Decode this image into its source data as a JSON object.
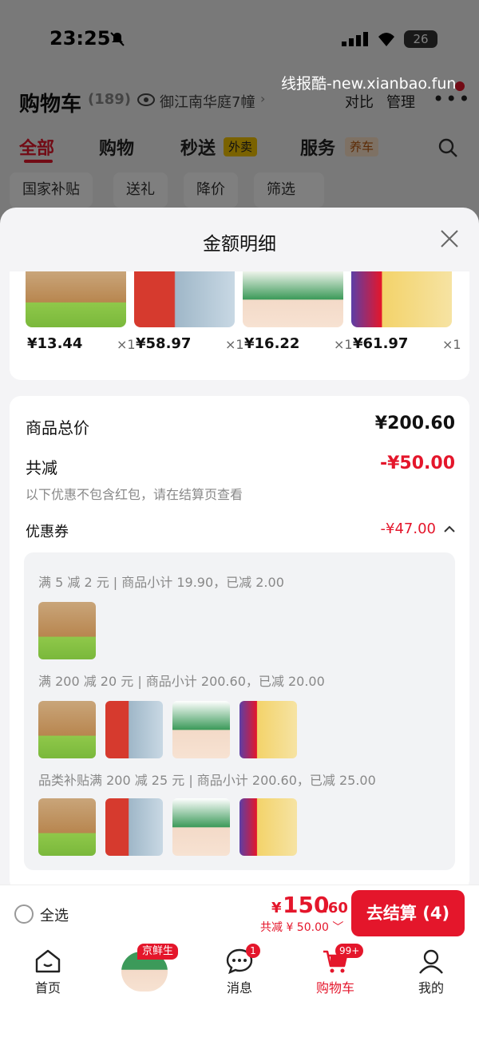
{
  "status": {
    "time": "23:25",
    "battery": "26"
  },
  "watermark": "线报酷-new.xianbao.fun",
  "header": {
    "title": "购物车",
    "count": "(189)",
    "address": "御江南华庭7幢",
    "compare": "对比",
    "manage": "管理"
  },
  "tabs": {
    "all": "全部",
    "shopping": "购物",
    "flash": "秒送",
    "flash_badge": "外卖",
    "service": "服务",
    "service_badge": "养车"
  },
  "filters": [
    "国家补贴",
    "送礼",
    "降价",
    "筛选"
  ],
  "sheet": {
    "title": "金额明细",
    "products": [
      {
        "price": "¥13.44",
        "qty": "×1"
      },
      {
        "price": "¥58.97",
        "qty": "×1"
      },
      {
        "price": "¥16.22",
        "qty": "×1"
      },
      {
        "price": "¥61.97",
        "qty": "×1"
      }
    ],
    "total_label": "商品总价",
    "total_value": "¥200.60",
    "reduce_label": "共减",
    "reduce_value": "-¥50.00",
    "note": "以下优惠不包含红包，请在结算页查看",
    "coupon_label": "优惠券",
    "coupon_value": "-¥47.00",
    "rules": [
      "满 5 减 2 元 | 商品小计 19.90，已减 2.00",
      "满 200 减 20 元 | 商品小计 200.60，已减 20.00",
      "品类补贴满 200 减 25 元 | 商品小计 200.60，已减 25.00"
    ]
  },
  "checkout": {
    "select_all": "全选",
    "symbol": "¥",
    "total_int": "150",
    "total_dec": ".60",
    "reduce": "共减 ¥ 50.00",
    "button": "去结算 (4)"
  },
  "nav": {
    "home": "首页",
    "fresh_tag": "京鲜生",
    "messages": "消息",
    "messages_badge": "1",
    "cart": "购物车",
    "cart_badge": "99+",
    "mine": "我的"
  },
  "colors": {
    "accent": "#e4162b"
  }
}
